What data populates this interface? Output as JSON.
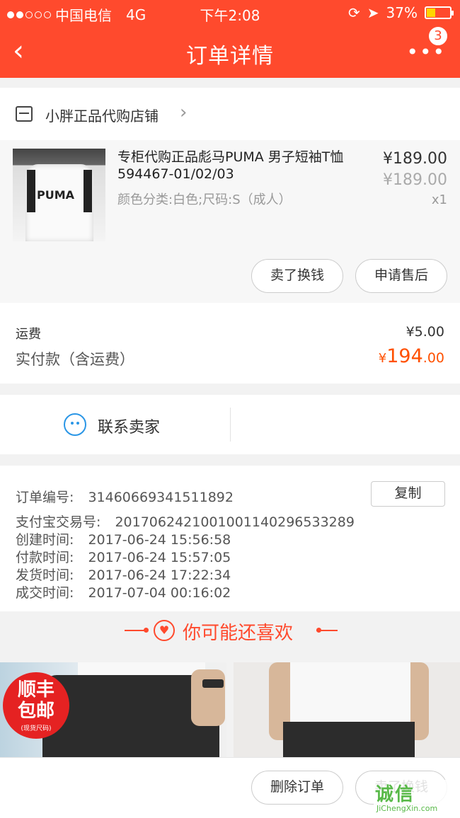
{
  "status_bar": {
    "carrier": "中国电信",
    "network": "4G",
    "time": "下午2:08",
    "battery": "37%",
    "battery_level": 0.37
  },
  "header": {
    "title": "订单详情",
    "badge_count": "3",
    "accent_color": "#ff4a2d"
  },
  "shop": {
    "name": "小胖正品代购店铺"
  },
  "product": {
    "title": "专柜代购正品彪马PUMA 男子短袖T恤594467-01/02/03",
    "spec": "颜色分类:白色;尺码:S（成人）",
    "price": "¥189.00",
    "original_price": "¥189.00",
    "quantity": "x1",
    "thumb_text": "PUMA",
    "actions": {
      "sell": "卖了换钱",
      "after_sale": "申请售后"
    }
  },
  "fees": {
    "shipping_label": "运费",
    "shipping_value": "¥5.00",
    "paid_label": "实付款（含运费）",
    "paid_currency": "¥",
    "paid_int": "194",
    "paid_dec": ".00",
    "paid_color": "#ff5000"
  },
  "contact": {
    "label": "联系卖家"
  },
  "order_info": {
    "copy_label": "复制",
    "rows": [
      {
        "label": "订单编号:",
        "value": "31460669341511892"
      },
      {
        "label": "支付宝交易号:",
        "value": "2017062421001001140296533289"
      },
      {
        "label": "创建时间:",
        "value": "2017-06-24 15:56:58"
      },
      {
        "label": "付款时间:",
        "value": "2017-06-24 15:57:05"
      },
      {
        "label": "发货时间:",
        "value": "2017-06-24 17:22:34"
      },
      {
        "label": "成交时间:",
        "value": "2017-07-04 00:16:02"
      }
    ]
  },
  "recommend": {
    "title": "你可能还喜欢",
    "badge": {
      "line1": "顺丰",
      "line2": "包邮",
      "line3": "(现货尺码)"
    }
  },
  "bottom_bar": {
    "delete": "删除订单",
    "sell": "卖了换钱"
  },
  "watermark": {
    "main": "诚信",
    "sub": "JiChengXin.com"
  }
}
